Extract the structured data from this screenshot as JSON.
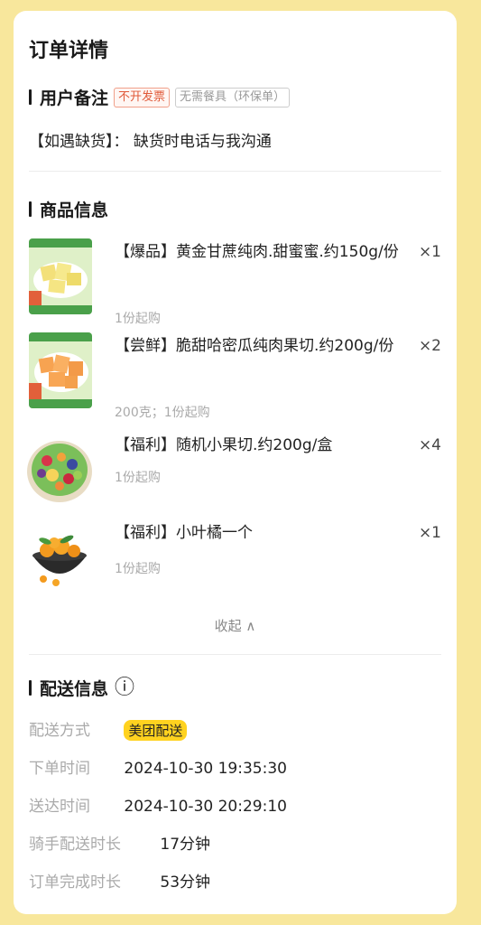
{
  "page": {
    "title": "订单详情"
  },
  "remark": {
    "title": "用户备注",
    "tags": [
      "不开发票",
      "无需餐具（环保单）"
    ],
    "text": "【如遇缺货】： 缺货时电话与我沟通"
  },
  "goods_section": {
    "title": "商品信息",
    "items": [
      {
        "name": "【爆品】黄金甘蔗纯肉.甜蜜蜜.约150g/份",
        "qty": "×1",
        "sub": "1份起购",
        "image": "sugarcane-image"
      },
      {
        "name": "【尝鲜】脆甜哈密瓜纯肉果切.约200g/份",
        "qty": "×2",
        "sub": "200克；1份起购",
        "image": "melon-image"
      },
      {
        "name": "【福利】随机小果切.约200g/盒",
        "qty": "×4",
        "sub": "1份起购",
        "image": "fruit-bowl-image"
      },
      {
        "name": "【福利】小叶橘一个",
        "qty": "×1",
        "sub": "1份起购",
        "image": "tangerine-image"
      }
    ],
    "collapse_label": "收起 ∧"
  },
  "delivery": {
    "title": "配送信息",
    "info_icon": "ⓘ",
    "rows": [
      {
        "label": "配送方式",
        "value": "美团配送"
      },
      {
        "label": "下单时间",
        "value": "2024-10-30 19:35:30"
      },
      {
        "label": "送达时间",
        "value": "2024-10-30 20:29:10"
      },
      {
        "label": "骑手配送时长",
        "value": "17分钟"
      },
      {
        "label": "订单完成时长",
        "value": "53分钟"
      }
    ]
  },
  "colors": {
    "background": "#f8e79c",
    "badge": "#ffd21f",
    "tag_red": "#e05a3a"
  }
}
